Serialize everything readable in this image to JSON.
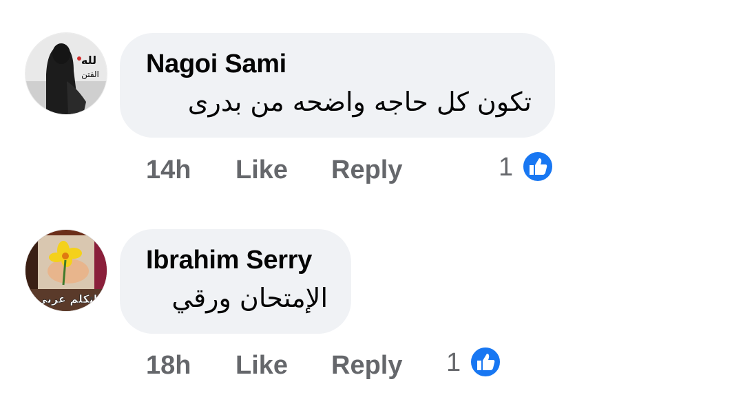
{
  "comments": [
    {
      "author": "Nagoi Sami",
      "text": "تكون كل حاجه واضحه من بدرى",
      "time": "14h",
      "like_label": "Like",
      "reply_label": "Reply",
      "reaction_count": "1",
      "reaction_icon": "thumbs-up-icon",
      "avatar_overlay_text": "لله الفتن"
    },
    {
      "author": "Ibrahim Serry",
      "text": "الإمتحان ورقي",
      "time": "18h",
      "like_label": "Like",
      "reply_label": "Reply",
      "reaction_count": "1",
      "reaction_icon": "thumbs-up-icon",
      "avatar_overlay_text": "اتكلم عربي"
    }
  ],
  "colors": {
    "bubble_bg": "#f0f2f5",
    "text_primary": "#050505",
    "text_secondary": "#65676b",
    "like_blue": "#1877f2"
  }
}
